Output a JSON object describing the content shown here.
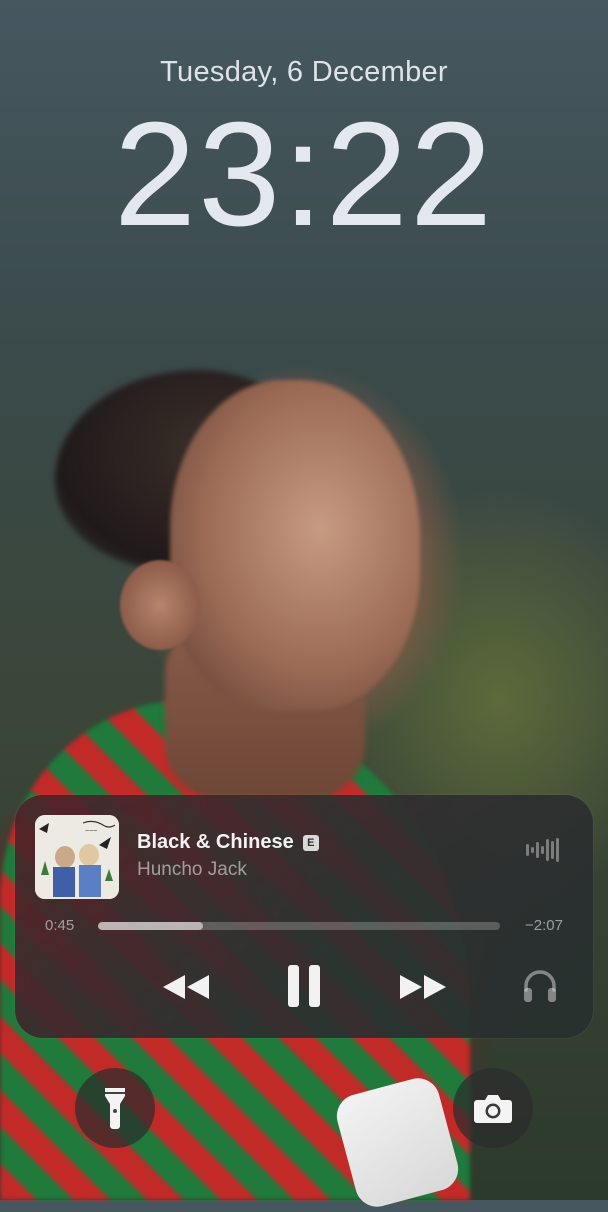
{
  "lockscreen": {
    "date": "Tuesday, 6 December",
    "time": "23:22"
  },
  "now_playing": {
    "title": "Black & Chinese",
    "explicit_badge": "E",
    "artist": "Huncho Jack",
    "elapsed": "0:45",
    "remaining": "−2:07",
    "progress_fraction": 0.26,
    "controls": [
      "rewind-icon",
      "pause-icon",
      "fast-forward-icon",
      "airpods-headphones-icon",
      "waveform-icon"
    ]
  },
  "quick_actions": [
    "flashlight-icon",
    "camera-icon"
  ],
  "colors": {
    "jersey_red": "#c22a28",
    "jersey_green": "#1f7a3b",
    "text": "#f2f2f2"
  }
}
